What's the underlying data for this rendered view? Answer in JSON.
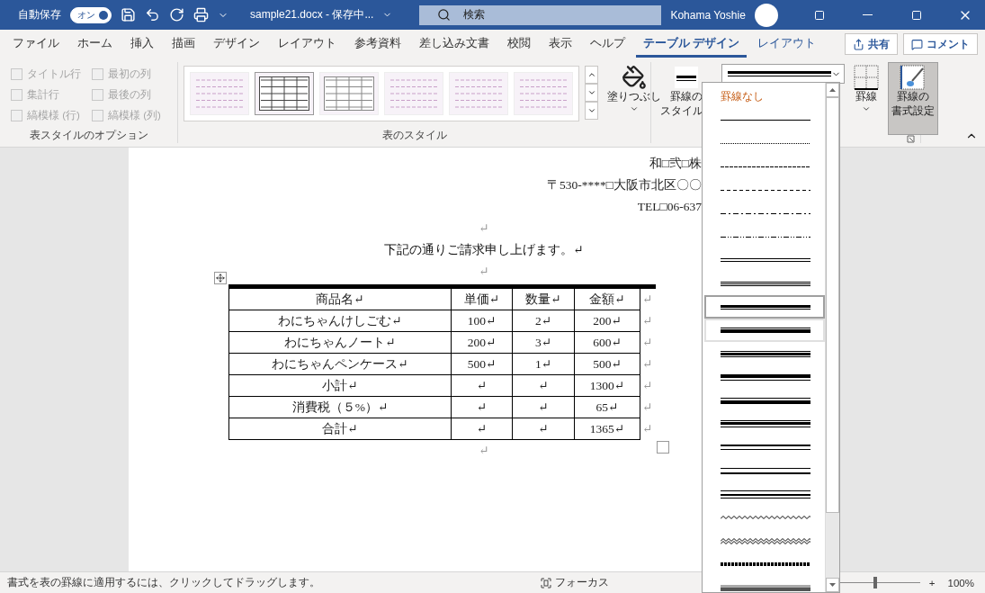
{
  "title_bar": {
    "autosave_label": "自動保存",
    "autosave_toggle": {
      "label": "オン",
      "on": true
    },
    "document_title": "sample21.docx - 保存中...",
    "search": {
      "placeholder": "検索"
    },
    "user_name": "Kohama Yoshie"
  },
  "ribbon_tabs": [
    {
      "label": "ファイル",
      "selected": false,
      "contextual": false
    },
    {
      "label": "ホーム",
      "selected": false,
      "contextual": false
    },
    {
      "label": "挿入",
      "selected": false,
      "contextual": false
    },
    {
      "label": "描画",
      "selected": false,
      "contextual": false
    },
    {
      "label": "デザイン",
      "selected": false,
      "contextual": false
    },
    {
      "label": "レイアウト",
      "selected": false,
      "contextual": false
    },
    {
      "label": "参考資料",
      "selected": false,
      "contextual": false
    },
    {
      "label": "差し込み文書",
      "selected": false,
      "contextual": false
    },
    {
      "label": "校閲",
      "selected": false,
      "contextual": false
    },
    {
      "label": "表示",
      "selected": false,
      "contextual": false
    },
    {
      "label": "ヘルプ",
      "selected": false,
      "contextual": false
    },
    {
      "label": "テーブル デザイン",
      "selected": true,
      "contextual": true
    },
    {
      "label": "レイアウト",
      "selected": false,
      "contextual": true
    }
  ],
  "share_button": "共有",
  "comment_button": "コメント",
  "style_options": {
    "label": "表スタイルのオプション",
    "checkboxes": [
      {
        "label": "タイトル行",
        "checked": false,
        "disabled": true
      },
      {
        "label": "集計行",
        "checked": false,
        "disabled": true
      },
      {
        "label": "縞模様 (行)",
        "checked": false,
        "disabled": true
      },
      {
        "label": "最初の列",
        "checked": false,
        "disabled": true
      },
      {
        "label": "最後の列",
        "checked": false,
        "disabled": true
      },
      {
        "label": "縞模様 (列)",
        "checked": false,
        "disabled": true
      }
    ]
  },
  "table_styles": {
    "label": "表のスタイル",
    "gallery": [
      {
        "kind": "dashed"
      },
      {
        "kind": "grid-dark"
      },
      {
        "kind": "grid-light"
      },
      {
        "kind": "dashed"
      },
      {
        "kind": "dashed"
      },
      {
        "kind": "dashed"
      }
    ],
    "shading_button": "塗りつぶし"
  },
  "borders": {
    "border_style_button": [
      "罫線の",
      "スタイル"
    ],
    "border_button": "罫線",
    "border_painter_button": {
      "lines": [
        "罫線の",
        "書式設定"
      ],
      "pressed": true
    }
  },
  "line_style_list": [
    {
      "kind": "text",
      "label": "罫線なし",
      "selected": false,
      "hovered": false
    },
    {
      "kind": "single",
      "selected": false,
      "hovered": false
    },
    {
      "kind": "dotted",
      "selected": false,
      "hovered": false
    },
    {
      "kind": "dashed-fine",
      "selected": false,
      "hovered": false
    },
    {
      "kind": "dashed",
      "selected": false,
      "hovered": false
    },
    {
      "kind": "dash-dot",
      "selected": false,
      "hovered": false
    },
    {
      "kind": "dash-dot-dot",
      "selected": false,
      "hovered": false
    },
    {
      "kind": "double",
      "selected": false,
      "hovered": false
    },
    {
      "kind": "triple",
      "selected": false,
      "hovered": false
    },
    {
      "kind": "thick-thin-small",
      "selected": true,
      "hovered": false
    },
    {
      "kind": "thin-thick-small",
      "selected": false,
      "hovered": true
    },
    {
      "kind": "thin-thick-thin-small",
      "selected": false,
      "hovered": false
    },
    {
      "kind": "thick-thin-medium",
      "selected": false,
      "hovered": false
    },
    {
      "kind": "thin-thick-medium",
      "selected": false,
      "hovered": false
    },
    {
      "kind": "thin-thick-thin-medium",
      "selected": false,
      "hovered": false
    },
    {
      "kind": "thick-thin-large",
      "selected": false,
      "hovered": false
    },
    {
      "kind": "thin-thick-large",
      "selected": false,
      "hovered": false
    },
    {
      "kind": "thin-thick-thin-large",
      "selected": false,
      "hovered": false
    },
    {
      "kind": "wave",
      "selected": false,
      "hovered": false
    },
    {
      "kind": "double-wave",
      "selected": false,
      "hovered": false
    },
    {
      "kind": "dash-dot-stroked",
      "selected": false,
      "hovered": false
    },
    {
      "kind": "emboss",
      "selected": false,
      "hovered": false
    }
  ],
  "document": {
    "letterhead": [
      "和□弐□株",
      "〒530-****□大阪市北区〇〇",
      "TEL□06-637"
    ],
    "blank_mark_1": "↵",
    "greeting": "下記の通りご請求申し上げます。↵",
    "blank_mark_2": "↵",
    "table": {
      "rows": [
        {
          "cells": [
            "商品名↵",
            "単価↵",
            "数量↵",
            "金額↵"
          ],
          "end_mark": "↵"
        },
        {
          "cells": [
            "わにちゃんけしごむ↵",
            "100↵",
            "2↵",
            "200↵"
          ],
          "end_mark": "↵"
        },
        {
          "cells": [
            "わにちゃんノート↵",
            "200↵",
            "3↵",
            "600↵"
          ],
          "end_mark": "↵"
        },
        {
          "cells": [
            "わにちゃんペンケース↵",
            "500↵",
            "1↵",
            "500↵"
          ],
          "end_mark": "↵"
        },
        {
          "cells": [
            "小計↵",
            "↵",
            "↵",
            "1300↵"
          ],
          "end_mark": "↵"
        },
        {
          "cells": [
            "消費税（５%）↵",
            "↵",
            "↵",
            "65↵"
          ],
          "end_mark": "↵"
        },
        {
          "cells": [
            "合計↵",
            "↵",
            "↵",
            "1365↵"
          ],
          "end_mark": "↵"
        }
      ]
    },
    "after_mark": "↵"
  },
  "status_bar": {
    "message": "書式を表の罫線に適用するには、クリックしてドラッグします。",
    "focus": "フォーカス",
    "zoom_plus": "+",
    "zoom": "100%",
    "zoom_slider": {
      "level": 0.5
    }
  }
}
